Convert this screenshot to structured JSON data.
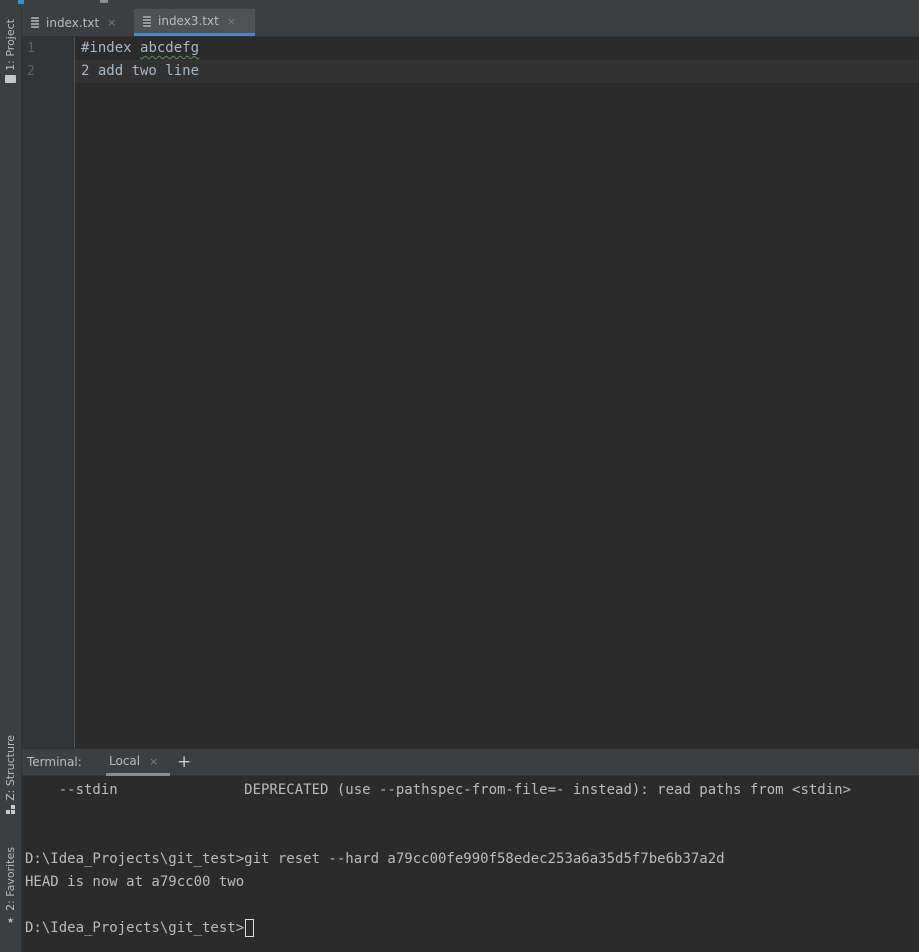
{
  "left_stripe": {
    "project_label": "1: Project",
    "structure_label": "Z: Structure",
    "favorites_label": "2: Favorites",
    "favorites_icon": "★"
  },
  "editor_tabs": [
    {
      "label": "index.txt",
      "close": "×",
      "active": false
    },
    {
      "label": "index3.txt",
      "close": "×",
      "active": true
    }
  ],
  "editor": {
    "line_numbers": [
      "1",
      "2"
    ],
    "line1_prefix": "#index ",
    "line1_word": "abcdefg",
    "line2": "2 add two line"
  },
  "terminal": {
    "title": "Terminal:",
    "tab_label": "Local",
    "tab_close": "×",
    "add_label": "+",
    "lines": [
      "    --stdin               DEPRECATED (use --pathspec-from-file=- instead): read paths from <stdin>",
      "",
      "",
      "D:\\Idea_Projects\\git_test>git reset --hard a79cc00fe990f58edec253a6a35d5f7be6b37a2d",
      "HEAD is now at a79cc00 two",
      ""
    ],
    "prompt": "D:\\Idea_Projects\\git_test>"
  },
  "colors": {
    "background": "#2b2b2b",
    "panel": "#3c3f41",
    "active_tab_underline": "#4a88c7",
    "text": "#a9b7c6"
  }
}
